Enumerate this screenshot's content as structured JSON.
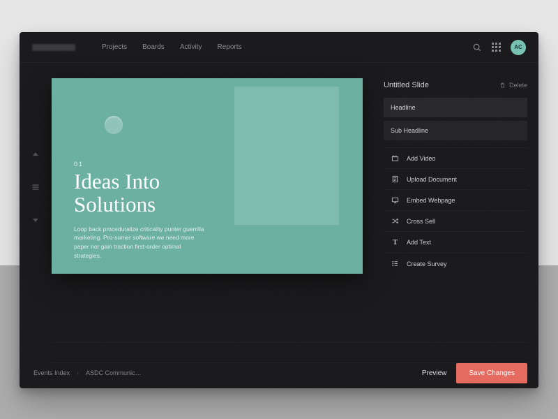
{
  "nav": {
    "projects": "Projects",
    "boards": "Boards",
    "activity": "Activity",
    "reports": "Reports"
  },
  "user": {
    "initials": "AC"
  },
  "slide": {
    "number": "01",
    "headline": "Ideas Into Solutions",
    "description": "Loop back proceduralize criticality punter guerrilla marketing. Pro-sumer software we need more paper nor gain traction first-order optimal strategies."
  },
  "panel": {
    "title": "Untitled Slide",
    "delete": "Delete",
    "headline_label": "Headline",
    "subheadline_label": "Sub Headline",
    "actions": {
      "add_video": "Add Video",
      "upload_document": "Upload Document",
      "embed_webpage": "Embed Webpage",
      "cross_sell": "Cross Sell",
      "add_text": "Add Text",
      "create_survey": "Create Survey"
    }
  },
  "breadcrumb": {
    "root": "Events Index",
    "current": "ASDC Communic…"
  },
  "footer": {
    "preview": "Preview",
    "save": "Save Changes"
  },
  "colors": {
    "accent": "#e56a5f",
    "canvas": "#6bb0a1",
    "avatar": "#78c2b4"
  }
}
